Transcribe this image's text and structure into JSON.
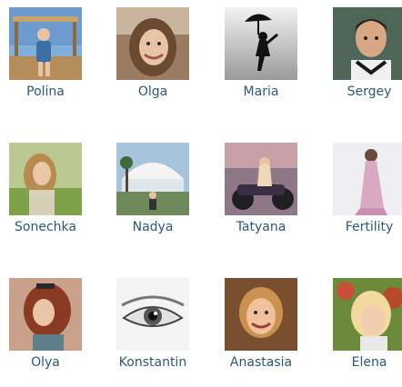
{
  "friends": [
    {
      "name": "Polina",
      "photo": "photo-seaside-girl",
      "bg": "#5a87b8"
    },
    {
      "name": "Olga",
      "photo": "photo-smiling-woman",
      "bg": "#8b6a52"
    },
    {
      "name": "Maria",
      "photo": "photo-umbrella-silhouette",
      "bg": "#bdbdbd"
    },
    {
      "name": "Sergey",
      "photo": "photo-man-portrait",
      "bg": "#3b4a42"
    },
    {
      "name": "Sonechka",
      "photo": "photo-girl-in-meadow",
      "bg": "#8aa85c"
    },
    {
      "name": "Nadya",
      "photo": "photo-modern-building",
      "bg": "#9fb4c4"
    },
    {
      "name": "Tatyana",
      "photo": "photo-woman-motorcycle",
      "bg": "#6b5a6e"
    },
    {
      "name": "Fertility",
      "photo": "photo-woman-in-dress",
      "bg": "#e7e7ea"
    },
    {
      "name": "Olya",
      "photo": "photo-girl-red-hair",
      "bg": "#b8654e"
    },
    {
      "name": "Konstantin",
      "photo": "photo-eye-closeup",
      "bg": "#dcdcdc"
    },
    {
      "name": "Anastasia",
      "photo": "photo-girl-smiling",
      "bg": "#6e4a2e"
    },
    {
      "name": "Elena",
      "photo": "photo-blonde-woman",
      "bg": "#a84a2a"
    }
  ]
}
